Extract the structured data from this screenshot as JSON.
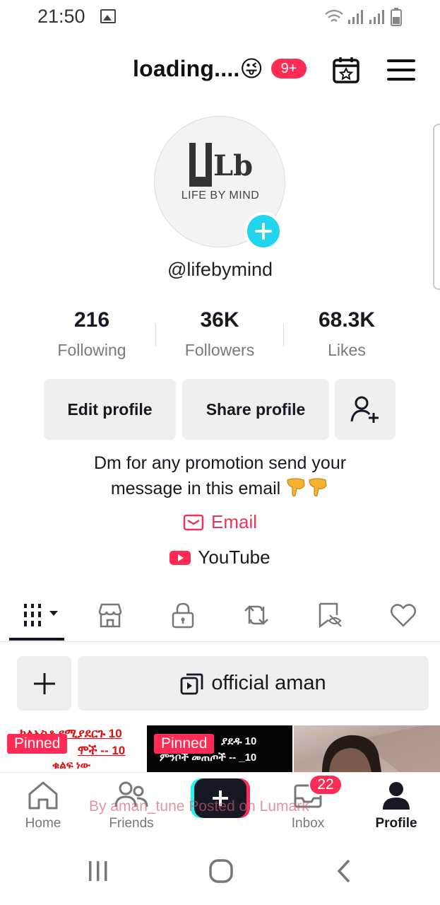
{
  "status_bar": {
    "time": "21:50"
  },
  "header": {
    "title": "loading....😜",
    "notification_badge": "9+"
  },
  "profile": {
    "avatar_logo_letters": "Lb",
    "avatar_logo_text": "LIFE BY MIND",
    "username": "@lifebymind",
    "stats": [
      {
        "value": "216",
        "label": "Following"
      },
      {
        "value": "36K",
        "label": "Followers"
      },
      {
        "value": "68.3K",
        "label": "Likes"
      }
    ],
    "buttons": {
      "edit": "Edit profile",
      "share": "Share profile"
    },
    "bio_line1": "Dm for any promotion send your",
    "bio_line2": "message in this email",
    "email_link": "Email",
    "youtube_link": "YouTube"
  },
  "tabs": [
    "videos-grid",
    "shop",
    "private",
    "reposts",
    "favorites",
    "liked"
  ],
  "collection": {
    "name": "official aman"
  },
  "thumbnails": [
    {
      "pinned_label": "Pinned",
      "text_lines": [
        "ካለአስቶ የሚያደርጉ 10",
        "ሞች -- 10",
        "ቁልፍ ነው"
      ]
    },
    {
      "pinned_label": "Pinned",
      "text_lines": [
        "ያደዱ 10",
        "ምንቦች መጠጦች -- _10"
      ]
    },
    {
      "pinned_label": ""
    }
  ],
  "bottom_nav": {
    "items": [
      "Home",
      "Friends",
      "",
      "Inbox",
      "Profile"
    ],
    "inbox_badge": "22",
    "watermark": "By aman_tune Posted on Lumark"
  },
  "colors": {
    "accent": "#fe2c55",
    "teal": "#20d5ec",
    "button_bg": "#efefef",
    "text": "#161823",
    "muted": "#7a7a7a"
  }
}
